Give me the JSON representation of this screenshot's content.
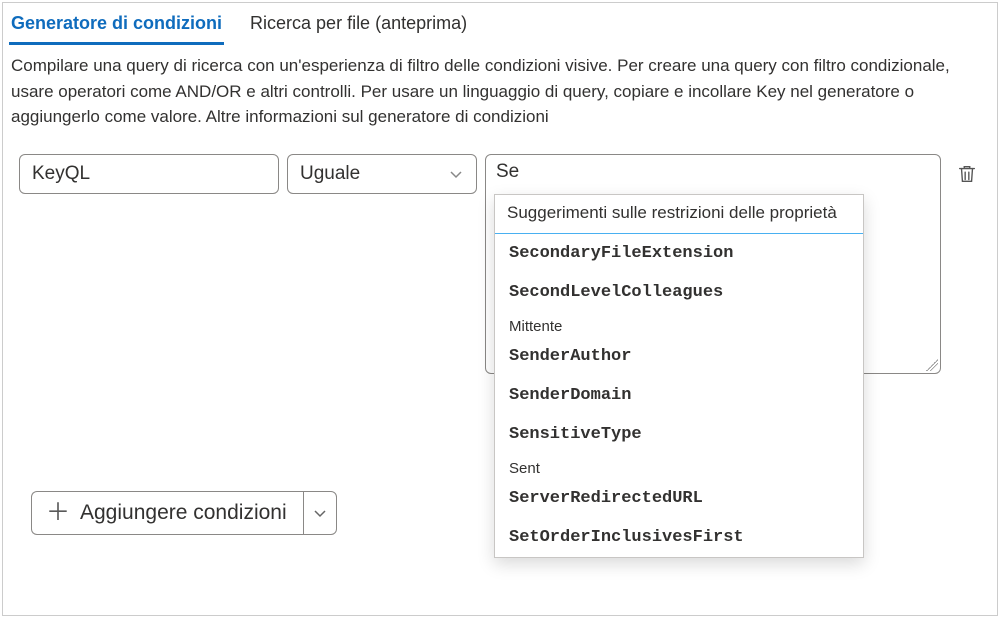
{
  "tabs": {
    "conditions": "Generatore di condizioni",
    "searchByFile": "Ricerca per file (anteprima)"
  },
  "description": "Compilare una query di ricerca con un'esperienza di filtro delle condizioni visive. Per creare una query con filtro condizionale, usare operatori come AND/OR e altri controlli. Per usare un linguaggio di query, copiare e incollare Key nel generatore o aggiungerlo come valore. Altre informazioni sul generatore di condizioni",
  "condition": {
    "field": "KeyQL",
    "operator": "Uguale",
    "value_typed": "Se"
  },
  "suggestions": {
    "header": "Suggerimenti sulle restrizioni delle proprietà",
    "items": [
      {
        "type": "prop",
        "text": "SecondaryFileExtension"
      },
      {
        "type": "prop",
        "text": "SecondLevelColleagues"
      },
      {
        "type": "group",
        "text": "Mittente"
      },
      {
        "type": "prop",
        "text": "SenderAuthor"
      },
      {
        "type": "prop",
        "text": "SenderDomain"
      },
      {
        "type": "prop",
        "text": "SensitiveType"
      },
      {
        "type": "group",
        "text": "Sent"
      },
      {
        "type": "prop",
        "text": "ServerRedirectedURL"
      },
      {
        "type": "prop",
        "text": "SetOrderInclusivesFirst"
      }
    ]
  },
  "buttons": {
    "addConditions": "Aggiungere condizioni"
  },
  "icons": {
    "chevron": "chevron-down-icon",
    "trash": "trash-icon",
    "plus": "plus-icon"
  }
}
